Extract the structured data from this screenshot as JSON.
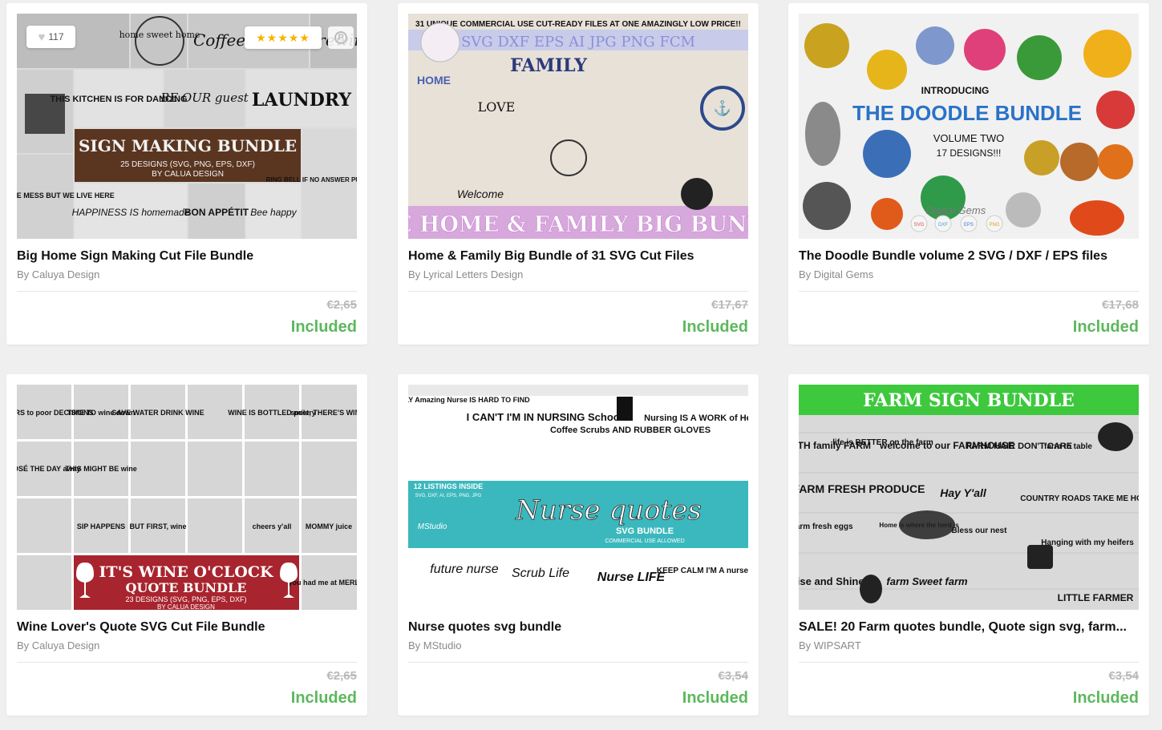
{
  "products": [
    {
      "title": "Big Home Sign Making Cut File Bundle",
      "author": "By Caluya Design",
      "old_price": "€2,65",
      "status": "Included",
      "favorites": "117",
      "rating_stars": "★★★★★",
      "thumb": {
        "lines": [
          "SIGN MAKING BUNDLE",
          "25 DESIGNS (SVG, PNG, EPS, DXF)",
          "BY CALUA DESIGN",
          "LAUNDRY",
          "THIS KITCHEN IS FOR DANCING",
          "BE OUR guest",
          "HAPPINESS IS homemade",
          "BON APPÉTIT",
          "RING BELL IF NO ANSWER PULL WEEDS",
          "EXCUSE THE MESS BUT WE LIVE HERE",
          "Bee happy",
          "Coffee love is brewing.",
          "home sweet home"
        ]
      }
    },
    {
      "title": "Home & Family Big Bundle of 31 SVG Cut Files",
      "author": "By Lyrical Letters Design",
      "old_price": "€17,67",
      "status": "Included",
      "thumb": {
        "lines": [
          "31 UNIQUE COMMERCIAL USE CUT-READY FILES AT ONE AMAZINGLY LOW PRICE!!",
          "SVG  DXF  EPS  AI  JPG  PNG  FCM",
          "FAMILY",
          "HOME",
          "LOVE",
          "Welcome",
          "THE HOME & FAMILY BIG BUNDLE"
        ]
      }
    },
    {
      "title": "The Doodle Bundle volume 2 SVG / DXF / EPS files",
      "author": "By Digital Gems",
      "old_price": "€17,68",
      "status": "Included",
      "thumb": {
        "lines": [
          "INTRODUCING",
          "THE DOODLE BUNDLE",
          "VOLUME TWO",
          "17 DESIGNS!!!",
          "Digital Gems",
          "SVG",
          "DXF",
          "EPS",
          "PNG"
        ]
      }
    },
    {
      "title": "Wine Lover's Quote SVG Cut File Bundle",
      "author": "By Caluya Design",
      "old_price": "€2,65",
      "status": "Included",
      "thumb": {
        "lines": [
          "IT'S WINE O'CLOCK",
          "QUOTE BUNDLE",
          "23 DESIGNS (SVG, PNG, EPS, DXF)",
          "BY CALUA DESIGN",
          "CHEERS to poor DECISIONS",
          "TIME TO wine down",
          "SAVE WATER DRINK WINE",
          "WINE IS BOTTLED poetry",
          "smile, THERE'S WINE.",
          "ROSÉ THE DAY away",
          "THIS MIGHT BE wine",
          "SIP HAPPENS",
          "BUT FIRST, wine",
          "cheers y'all",
          "MOMMY juice",
          "you had me at MERLOT"
        ]
      }
    },
    {
      "title": "Nurse quotes svg bundle",
      "author": "By MStudio",
      "old_price": "€3,54",
      "status": "Included",
      "thumb": {
        "lines": [
          "12 LISTINGS INSIDE",
          "SVG, DXF, AI, EPS, PNG, JPG",
          "Nurse quotes",
          "SVG BUNDLE",
          "COMMERCIAL USE ALLOWED",
          "A TRULY Amazing Nurse IS HARD TO FIND",
          "I CAN'T I'M IN NURSING School",
          "Coffee Scrubs AND RUBBER GLOVES",
          "Nursing IS A WORK of Heart",
          "future nurse",
          "Scrub Life",
          "Nurse LIFE",
          "KEEP CALM I'M A nurse",
          "MStudio"
        ]
      }
    },
    {
      "title": "SALE! 20 Farm quotes bundle, Quote sign svg, farm...",
      "author": "By WIPSART",
      "old_price": "€3,54",
      "status": "Included",
      "thumb": {
        "lines": [
          "FARM SIGN BUNDLE",
          "FAITH family FARM",
          "life is BETTER on the farm",
          "welcome to our FARMHOUSE",
          "FARM HAIR DON'T CARE",
          "farm to table",
          "FARM FRESH PRODUCE",
          "Hay Y'all",
          "COUNTRY ROADS TAKE ME HOME",
          "farm fresh eggs",
          "Home is where the herd is",
          "Bless our nest",
          "Hanging with my heifers",
          "Rise and Shine",
          "farm Sweet farm",
          "LITTLE FARMER"
        ]
      }
    }
  ],
  "colors": {
    "included": "#5cb85c",
    "old_price": "#b9b9b9",
    "farm_banner": "#3ec83e",
    "nurse_teal": "#3bb8bd",
    "wine_red": "#a8242e"
  }
}
